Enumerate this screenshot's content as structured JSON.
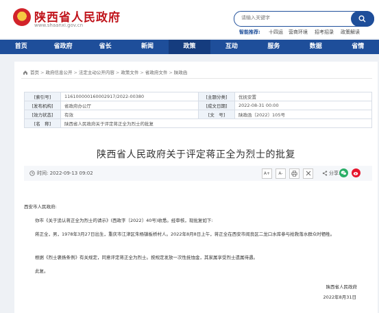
{
  "header": {
    "site_title": "陕西省人民政府",
    "site_url": "www.shaanxi.gov.cn",
    "search_placeholder": "请输入关键字",
    "smart_label": "智能推荐:",
    "smart_links": [
      "十四运",
      "营商环境",
      "招考招录",
      "政策解读"
    ]
  },
  "nav": {
    "items": [
      "首页",
      "省政府",
      "省长",
      "新闻",
      "政策",
      "互动",
      "服务",
      "数据",
      "省情"
    ],
    "active": "政策"
  },
  "breadcrumb": [
    "首页",
    "政府信息公开",
    "法定主动公开内容",
    "政策文件",
    "省政府文件",
    "陕政函"
  ],
  "meta": {
    "rows": [
      {
        "k1": "[索引号]",
        "v1": "11610000016000291​7/2022-00380",
        "k2": "[主题分类]",
        "v2": "优抚安置"
      },
      {
        "k1": "[发布机构]",
        "v1": "省政府办公厅",
        "k2": "[成文日期]",
        "v2": "2022-08-31 00:00"
      },
      {
        "k1": "[效力状态]",
        "v1": "有效",
        "k2": "[文　号]",
        "v2": "陕政函〔2022〕105号"
      },
      {
        "k1": "[名　称]",
        "v1": "陕西省人民政府关于评定蒋正全为烈士的批复"
      }
    ]
  },
  "document": {
    "title": "陕西省人民政府关于评定蒋正全为烈士的批复",
    "time_label": "时间: 2022-09-13 09:02",
    "font_large": "A+",
    "font_small": "A-",
    "share_label": "分享:",
    "salutation": "西安市人民政府:",
    "p1": "你市《关于追认蒋正全为烈士的请示》(西政字〔2022〕40号)收悉。经审核，现批复如下:",
    "p2": "蒋正全，男，1978年3月27日出生，重庆市江津区朱杨镇板桥村人。2022年8月8日上午，蒋正全在西安市阎良区二龙口水库参与抢救落水群众时牺牲。",
    "p3": "根据《烈士褒扬条例》有关规定，同意评定蒋正全为烈士。按规定发放一次性抚恤金，其家属享受烈士遗属待遇。",
    "p4": "此复。",
    "signature": "陕西省人民政府",
    "sign_date": "2022年8月31日"
  },
  "colors": {
    "brand_blue": "#1e4e9a",
    "brand_red": "#c0141b"
  }
}
